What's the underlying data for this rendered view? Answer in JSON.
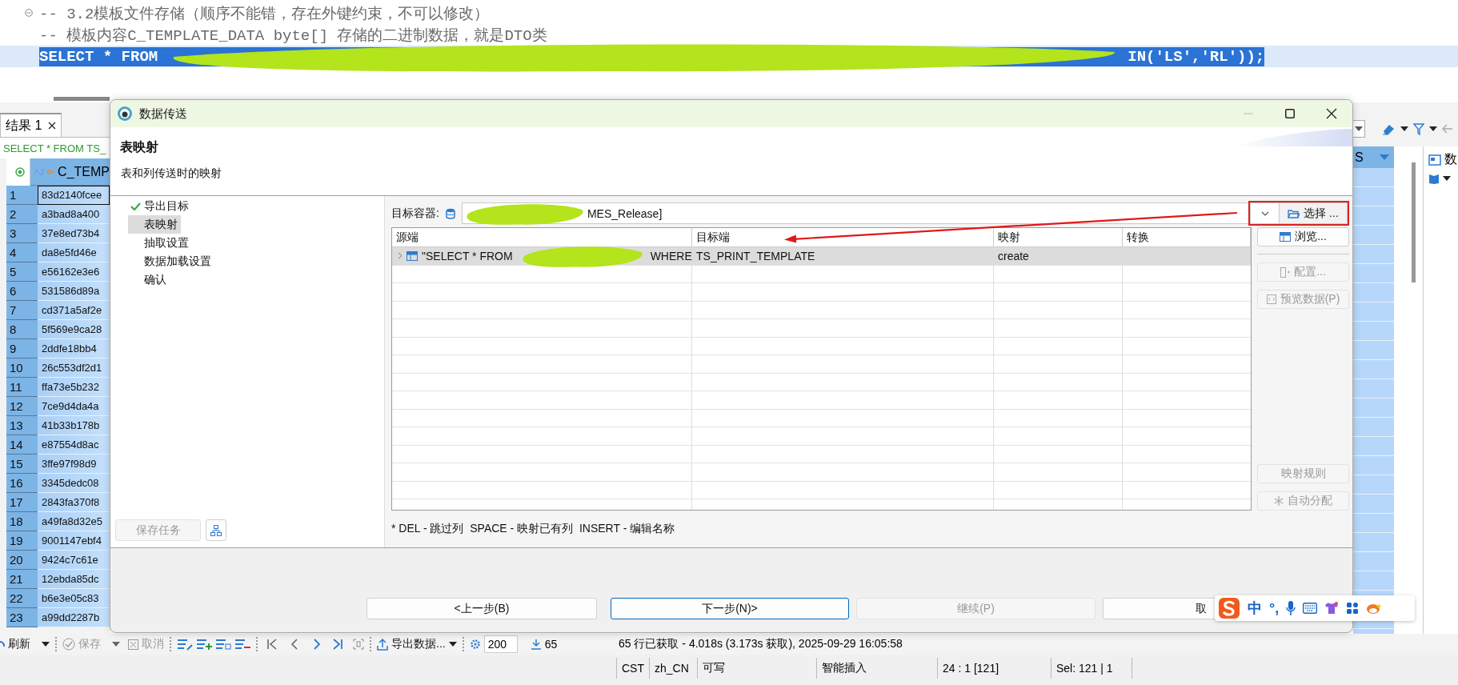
{
  "editor": {
    "lines": [
      {
        "kind": "comment",
        "text": "-- 3.2模板文件存储（顺序不能错，存在外键约束，不可以修改）",
        "selected": false
      },
      {
        "kind": "comment",
        "text": "-- 模板内容C_TEMPLATE_DATA byte[] 存储的二进制数据，就是DTO类",
        "selected": false
      },
      {
        "kind": "code",
        "parts": [
          {
            "kind": "text",
            "text": "SELECT * FROM"
          },
          {
            "kind": "redaction"
          },
          {
            "kind": "text",
            "text": "IN('LS','RL'));"
          }
        ],
        "selected": true
      }
    ]
  },
  "results": {
    "tab": "结果 1",
    "query": "SELECT * FROM TS_",
    "column": "C_TEMP",
    "column_2": "S",
    "rows": [
      {
        "number": "1",
        "value": "83d2140fcee",
        "focused": true
      },
      {
        "number": "2",
        "value": "a3bad8a400",
        "focused": false
      },
      {
        "number": "3",
        "value": "37e8ed73b4",
        "focused": false
      },
      {
        "number": "4",
        "value": "da8e5fd46e",
        "focused": false
      },
      {
        "number": "5",
        "value": "e56162e3e6",
        "focused": false
      },
      {
        "number": "6",
        "value": "531586d89a",
        "focused": false
      },
      {
        "number": "7",
        "value": "cd371a5af2e",
        "focused": false
      },
      {
        "number": "8",
        "value": "5f569e9ca28",
        "focused": false
      },
      {
        "number": "9",
        "value": "2ddfe18bb4",
        "focused": false
      },
      {
        "number": "10",
        "value": "26c553df2d1",
        "focused": false
      },
      {
        "number": "11",
        "value": "ffa73e5b232",
        "focused": false
      },
      {
        "number": "12",
        "value": "7ce9d4da4a",
        "focused": false
      },
      {
        "number": "13",
        "value": "41b33b178b",
        "focused": false
      },
      {
        "number": "14",
        "value": "e87554d8ac",
        "focused": false
      },
      {
        "number": "15",
        "value": "3ffe97f98d9",
        "focused": false
      },
      {
        "number": "16",
        "value": "3345dedc08",
        "focused": false
      },
      {
        "number": "17",
        "value": "2843fa370f8",
        "focused": false
      },
      {
        "number": "18",
        "value": "a49fa8d32e5",
        "focused": false
      },
      {
        "number": "19",
        "value": "9001147ebf4",
        "focused": false
      },
      {
        "number": "20",
        "value": "9424c7c61e",
        "focused": false
      },
      {
        "number": "21",
        "value": "12ebda85dc",
        "focused": false
      },
      {
        "number": "22",
        "value": "b6e3e05c83",
        "focused": false
      },
      {
        "number": "23",
        "value": "a99dd2287b",
        "focused": false
      }
    ]
  },
  "side_panel": {
    "label": "数"
  },
  "toolbar": {
    "refresh": "刷新",
    "save": {
      "label": "保存",
      "disabled": true
    },
    "cancel": {
      "label": "取消",
      "disabled": true
    },
    "export": "导出数据...",
    "fetch_size": "200",
    "row_count": "65",
    "message": "65 行已获取 - 4.018s (3.173s 获取), 2025-09-29 16:05:58"
  },
  "status_bar": [
    "CST",
    "zh_CN",
    "可写",
    "智能插入",
    "24 : 1 [121]",
    "Sel: 121 | 1"
  ],
  "dialog": {
    "title": "数据传送",
    "page_title": "表映射",
    "page_subtitle": "表和列传送时的映射",
    "steps": [
      {
        "label": "导出目标",
        "done": true,
        "selected": false
      },
      {
        "label": "表映射",
        "done": false,
        "selected": true
      },
      {
        "label": "抽取设置",
        "done": false,
        "selected": false
      },
      {
        "label": "数据加载设置",
        "done": false,
        "selected": false
      },
      {
        "label": "确认",
        "done": false,
        "selected": false
      }
    ],
    "save_task": {
      "label": "保存任务",
      "disabled": true
    },
    "target_label": "目标容器:",
    "target_value": "MES_Release]",
    "choose_button": "选择 ...",
    "columns": [
      "源端",
      "目标端",
      "映射",
      "转换"
    ],
    "rows": [
      {
        "source_start": "\"SELECT * FROM",
        "source_end": "WHERE",
        "target": "TS_PRINT_TEMPLATE",
        "mapping": "create",
        "selected": true
      }
    ],
    "side_buttons": [
      {
        "kind": "browse",
        "label": "浏览...",
        "disabled": false
      },
      {
        "kind": "config",
        "label": "配置...",
        "disabled": true
      },
      {
        "kind": "preview",
        "label": "预览数据(P)",
        "disabled": true
      },
      {
        "kind": "rules",
        "label": "映射规则",
        "disabled": true
      },
      {
        "kind": "auto",
        "label": "自动分配",
        "disabled": true
      }
    ],
    "hint": "* DEL - 跳过列  SPACE - 映射已有列  INSERT - 编辑名称",
    "nav_buttons": [
      {
        "label": "<上一步(B)",
        "disabled": false,
        "default": false
      },
      {
        "label": "下一步(N)>",
        "disabled": false,
        "default": true
      },
      {
        "label": "继续(P)",
        "disabled": true,
        "default": false
      },
      {
        "label": "取",
        "disabled": false,
        "default": false
      }
    ]
  },
  "ime_bar": {
    "mode": "中",
    "punctuation": "°,"
  }
}
